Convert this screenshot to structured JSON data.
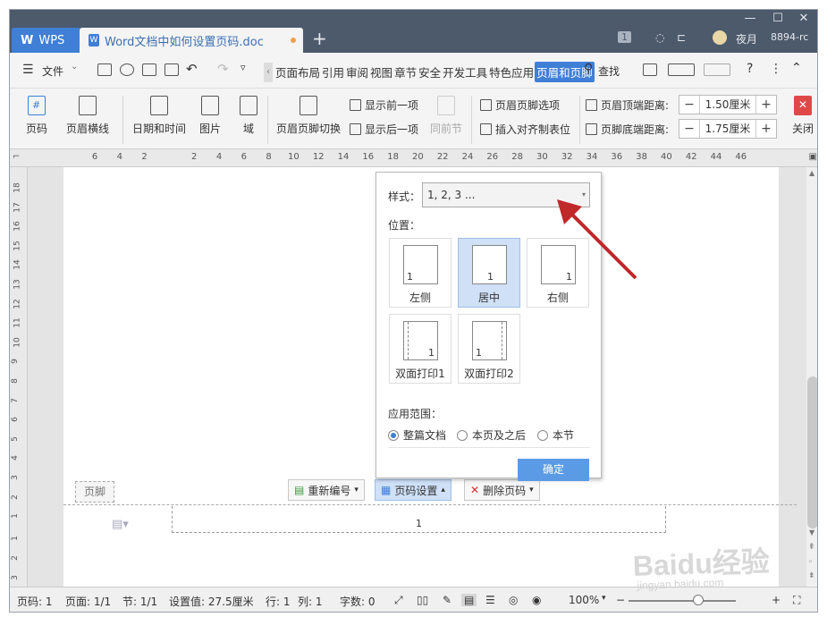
{
  "window_controls": {
    "min": "—",
    "max": "☐",
    "close": "✕"
  },
  "tabs": {
    "wps": "WPS",
    "doc": "Word文档中如何设置页码.doc",
    "new_tab": "+"
  },
  "titlebar_right": {
    "counter": "1",
    "user": "夜月",
    "user_id": "8894-rc"
  },
  "menubar": {
    "file": "文件",
    "menus": [
      "页面布局",
      "引用",
      "审阅",
      "视图",
      "章节",
      "安全",
      "开发工具",
      "特色应用",
      "页眉和页脚"
    ],
    "active_menu_index": 8,
    "find": "查找"
  },
  "ribbon": {
    "page_number": "页码",
    "header_line": "页眉横线",
    "datetime": "日期和时间",
    "picture": "图片",
    "field": "域",
    "header_footer_switch": "页眉页脚切换",
    "show_prev": "显示前一项",
    "show_next": "显示后一项",
    "same_as_prev": "同前节",
    "hf_options": "页眉页脚选项",
    "insert_align_tab": "插入对齐制表位",
    "header_top_label": "页眉顶端距离:",
    "header_top_value": "1.50厘米",
    "footer_bottom_label": "页脚底端距离:",
    "footer_bottom_value": "1.75厘米",
    "close": "关闭"
  },
  "ruler_h": [
    "6",
    "4",
    "2",
    "",
    "2",
    "4",
    "6",
    "8",
    "10",
    "12",
    "14",
    "16",
    "18",
    "20",
    "22",
    "24",
    "26",
    "28",
    "30",
    "32",
    "34",
    "36",
    "38",
    "40",
    "42",
    "44",
    "46"
  ],
  "ruler_v": [
    "18",
    "17",
    "16",
    "15",
    "14",
    "13",
    "12",
    "11",
    "10",
    "9",
    "8",
    "7",
    "6",
    "5",
    "4",
    "3",
    "2",
    "1"
  ],
  "ruler_v_bottom": [
    "1",
    "2",
    "3"
  ],
  "footer": {
    "tag": "页脚",
    "page_number": "1",
    "renumber": "重新编号",
    "page_setup": "页码设置",
    "delete_page_number": "删除页码"
  },
  "panel": {
    "style_label": "样式：",
    "style_value": "1, 2, 3 ...",
    "position_label": "位置：",
    "positions": [
      "左侧",
      "居中",
      "右侧",
      "双面打印1",
      "双面打印2"
    ],
    "selected_position": "居中",
    "sample_number": "1",
    "scope_label": "应用范围：",
    "scope_options": [
      "整篇文档",
      "本页及之后",
      "本节"
    ],
    "selected_scope": "整篇文档",
    "ok": "确定"
  },
  "statusbar": {
    "page_num": "页码: 1",
    "page": "页面: 1/1",
    "section": "节: 1/1",
    "setting": "设置值: 27.5厘米",
    "row": "行: 1",
    "col": "列: 1",
    "words": "字数: 0",
    "zoom": "100%",
    "zoom_out": "−",
    "zoom_in": "+"
  },
  "watermark": {
    "main": "Baidu经验",
    "sub": "jingyan.baidu.com"
  },
  "colors": {
    "accent": "#3f7fd6",
    "titlebar": "#4d5a6c",
    "arrow": "#c0282a",
    "selected": "#cfe0f7"
  }
}
